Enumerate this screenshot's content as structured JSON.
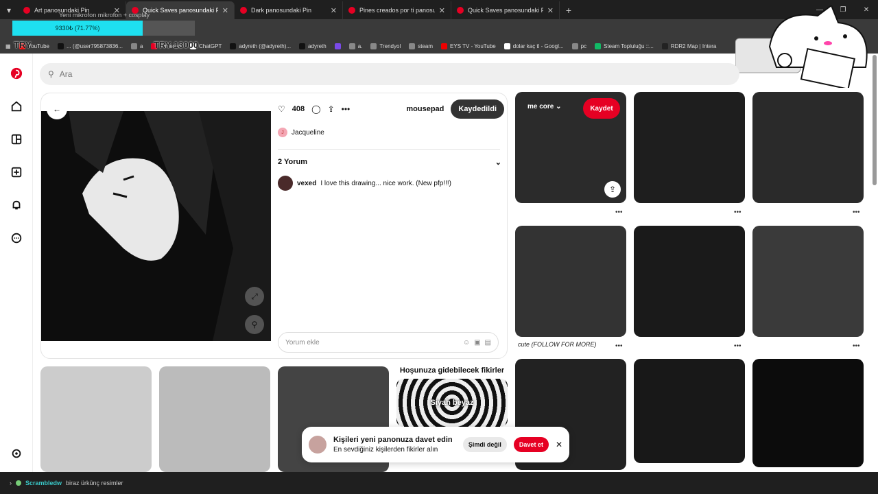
{
  "tabs": [
    {
      "label": "Art panosundaki Pin"
    },
    {
      "label": "Quick Saves panosundaki Pin"
    },
    {
      "label": "Dark panosundaki Pin"
    },
    {
      "label": "Pines creados por ti panosunda"
    },
    {
      "label": "Quick Saves panosundaki Pin"
    }
  ],
  "overlay": {
    "progress": "9330₺ (71.77%)",
    "try_left": "TRY",
    "try_right": "TRY 13000",
    "faded": "Yeni mikrofon mikrofon + cosplay"
  },
  "bookmarks": [
    "YouTube",
    "... (@user795873836...",
    "a",
    "Pinterest",
    "ChatGPT",
    "adyreth (@adyreth)...",
    "adyreth",
    "a.",
    "Trendyol",
    "steam",
    "EYS TV - YouTube",
    "dolar kaç tl - Googl...",
    "pc",
    "Steam Topluluğu ::...",
    "RDR2 Map | Intera"
  ],
  "search": {
    "placeholder": "Ara"
  },
  "pin": {
    "likes": "408",
    "board": "mousepad",
    "saved_label": "Kaydedildi",
    "author": "Jacqueline",
    "author_initial": "J",
    "comments_header": "2 Yorum",
    "comment_user": "vexed",
    "comment_text": "I love this drawing... nice work. (New pfp!!!)",
    "comment_placeholder": "Yorum ekle"
  },
  "grid": {
    "board_name": "me core",
    "save_label": "Kaydet",
    "caption": "cute (FOLLOW FOR MORE)"
  },
  "ideas": {
    "title": "Hoşunuza gidebilecek fikirler",
    "card": "Siyah beyaz"
  },
  "invite": {
    "title": "Kişileri yeni panonuza davet edin",
    "subtitle": "En sevdiğiniz kişilerden fikirler alın",
    "not_now": "Şimdi değil",
    "invite": "Davet et"
  },
  "chat": {
    "user": "Scrambledw",
    "message": "biraz ürkünç resimler"
  },
  "colors": {
    "accent": "#e60023",
    "overlay": "#1ee0f0"
  }
}
